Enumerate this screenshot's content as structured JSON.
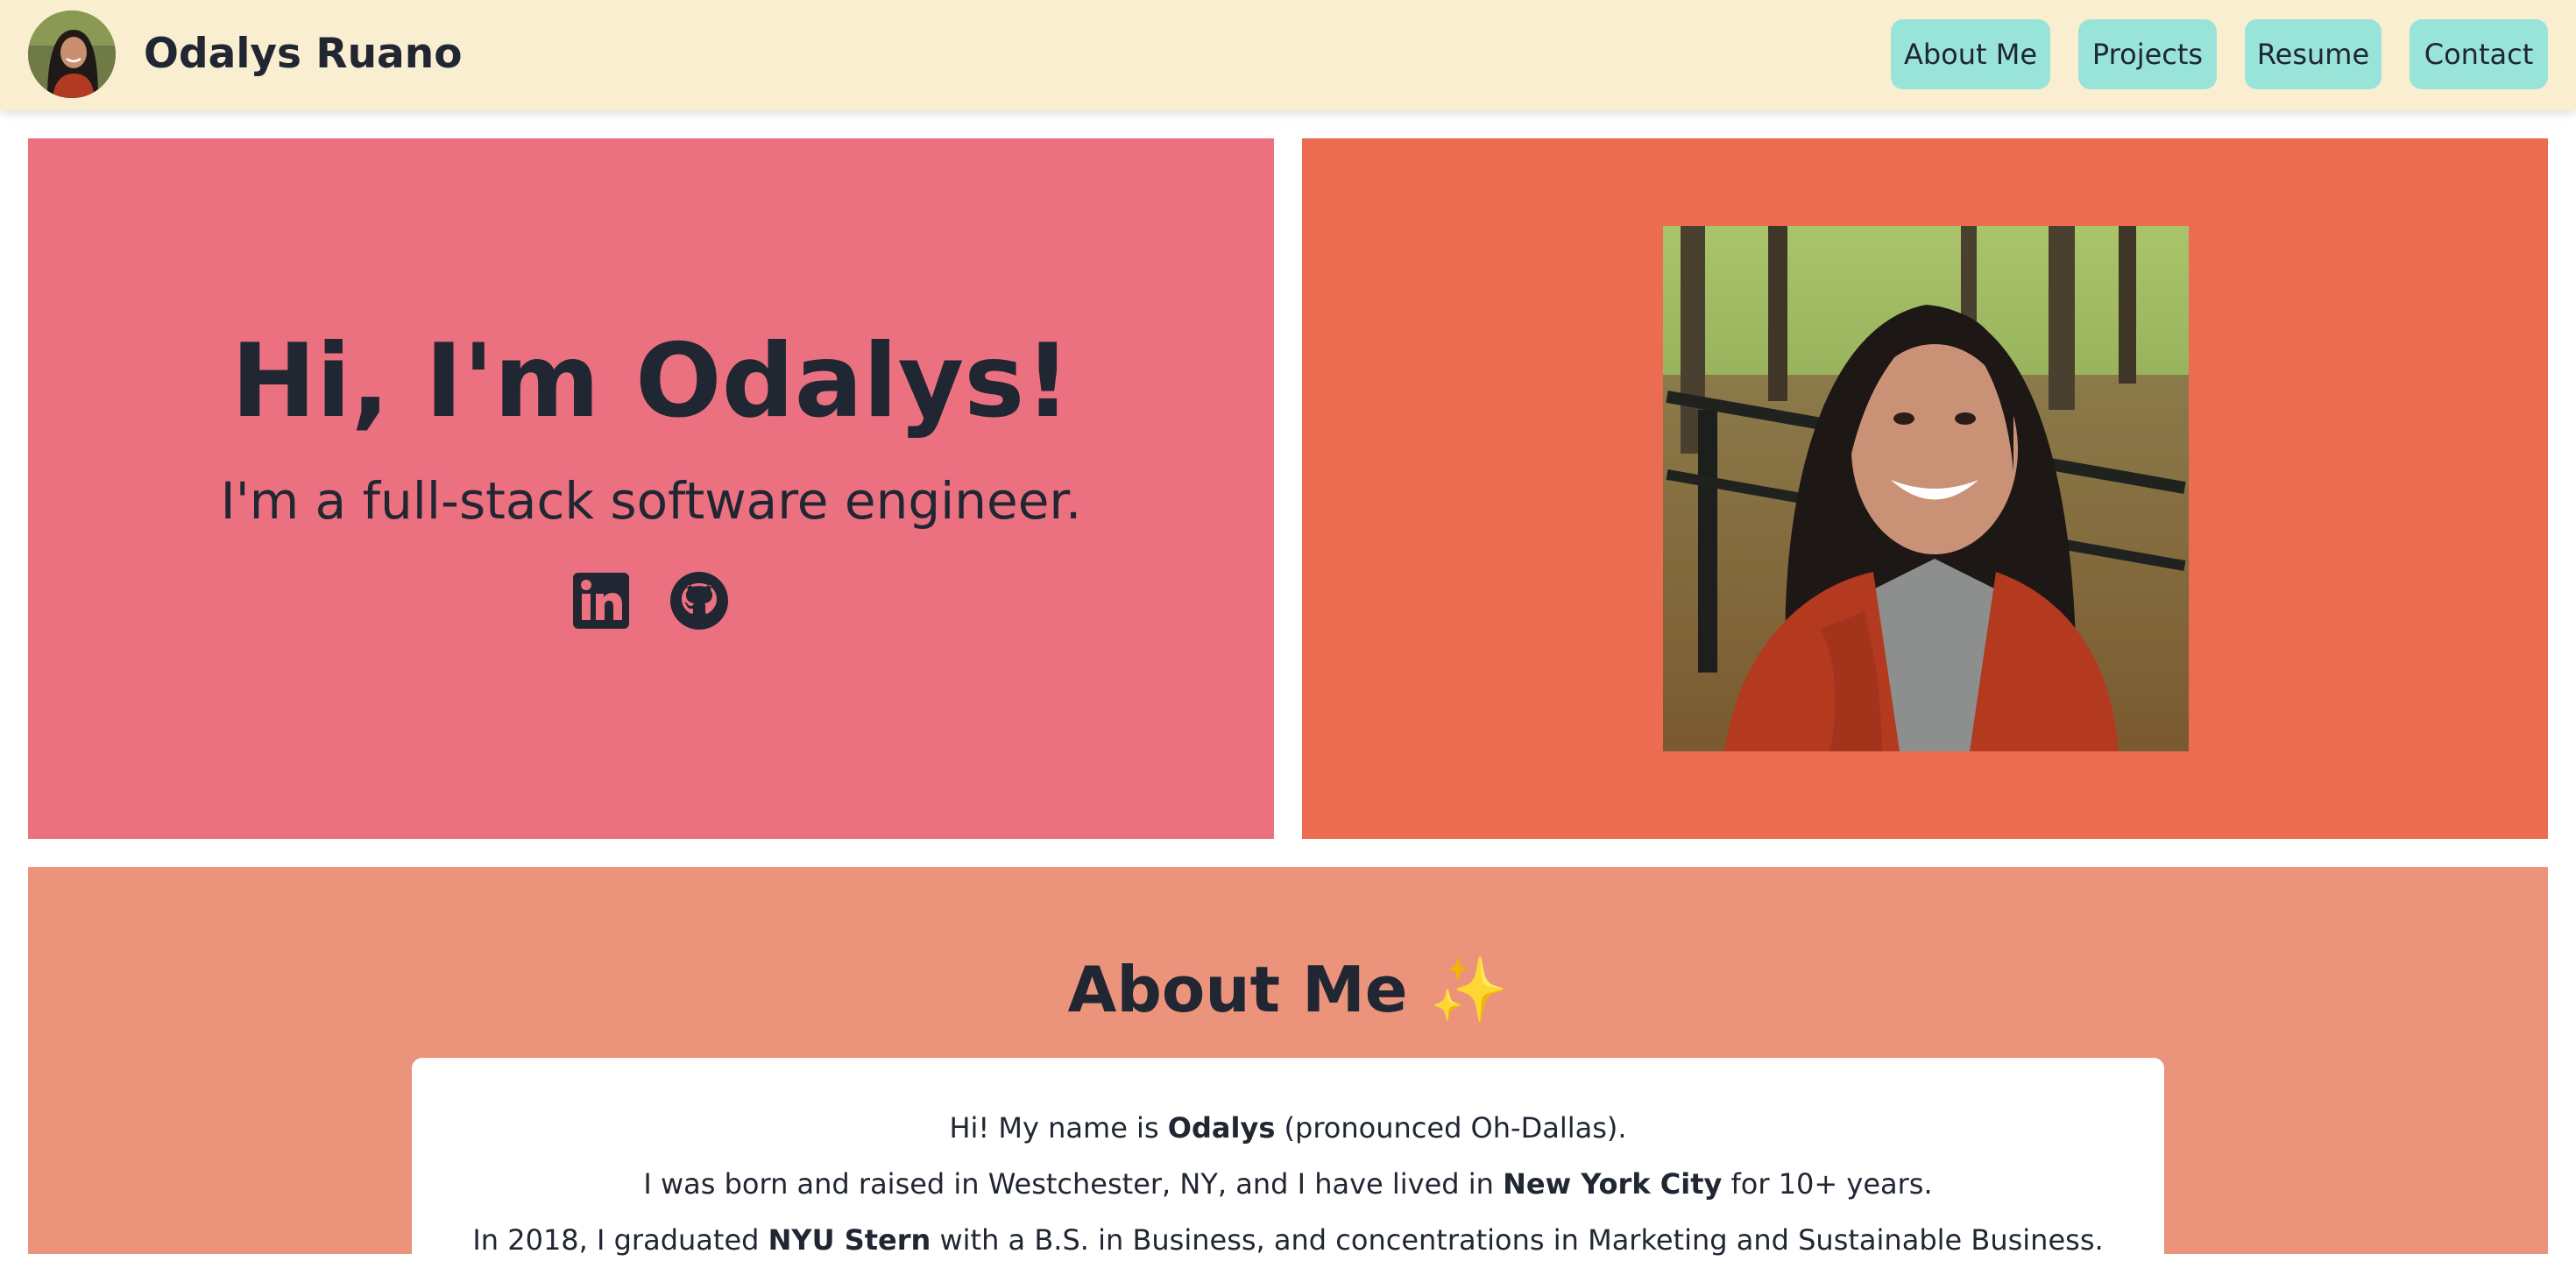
{
  "header": {
    "site_name": "Odalys Ruano",
    "nav": [
      {
        "label": "About Me"
      },
      {
        "label": "Projects"
      },
      {
        "label": "Resume"
      },
      {
        "label": "Contact"
      }
    ]
  },
  "hero": {
    "heading": "Hi, I'm Odalys!",
    "subheading": "I'm a full-stack software engineer.",
    "social_icons": [
      "linkedin-icon",
      "github-icon"
    ]
  },
  "about": {
    "title": "About Me",
    "title_emoji": "✨",
    "lines": [
      {
        "before": "Hi! My name is ",
        "bold": "Odalys",
        "after": " (pronounced Oh-Dallas)."
      },
      {
        "before": "I was born and raised in Westchester, NY, and I have lived in ",
        "bold": "New York City",
        "after": " for 10+ years."
      },
      {
        "before": "In 2018, I graduated ",
        "bold": "NYU Stern",
        "after": " with a B.S. in Business, and concentrations in Marketing and Sustainable Business."
      }
    ]
  },
  "colors": {
    "header_bg": "#faeed1",
    "nav_button_bg": "#99e4d9",
    "hero_left_bg": "#eb7180",
    "hero_right_bg": "#ec6c51",
    "about_bg": "#ec937c",
    "text": "#202632"
  }
}
